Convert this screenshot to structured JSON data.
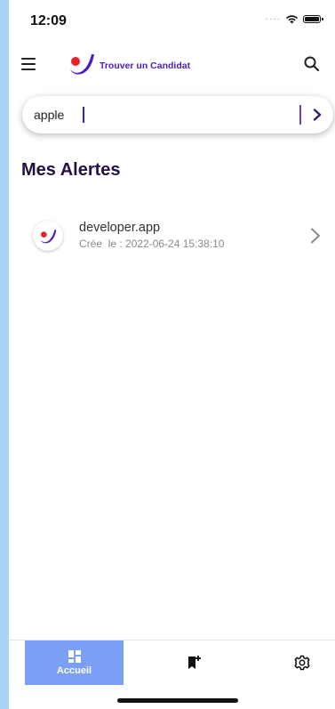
{
  "status_bar": {
    "time": "12:09",
    "signal_icon": "signal-dots-icon",
    "wifi_icon": "wifi-icon",
    "battery_icon": "battery-icon"
  },
  "app_bar": {
    "menu_icon": "hamburger-menu-icon",
    "brand_name": "Trouver un Candidat",
    "search_icon": "search-icon"
  },
  "search": {
    "value": "apple",
    "submit_icon": "chevron-right-icon"
  },
  "alerts": {
    "title": "Mes Alertes",
    "items": [
      {
        "name": "developer.app",
        "created": "Crée  le : 2022-06-24 15:38:10",
        "avatar_icon": "brand-logo-icon",
        "chevron_icon": "chevron-right-icon"
      }
    ]
  },
  "bottom_nav": {
    "tabs": [
      {
        "label": "Accueil",
        "icon": "dashboard-icon",
        "active": true
      },
      {
        "label": "",
        "icon": "bookmark-add-icon",
        "active": false
      },
      {
        "label": "",
        "icon": "gear-icon",
        "active": false
      }
    ]
  },
  "colors": {
    "page_background": "#a8d4f8",
    "brand_purple": "#4a1fb8",
    "brand_red": "#e8212b",
    "title": "#241046",
    "active_tab": "#7b9ff5"
  }
}
